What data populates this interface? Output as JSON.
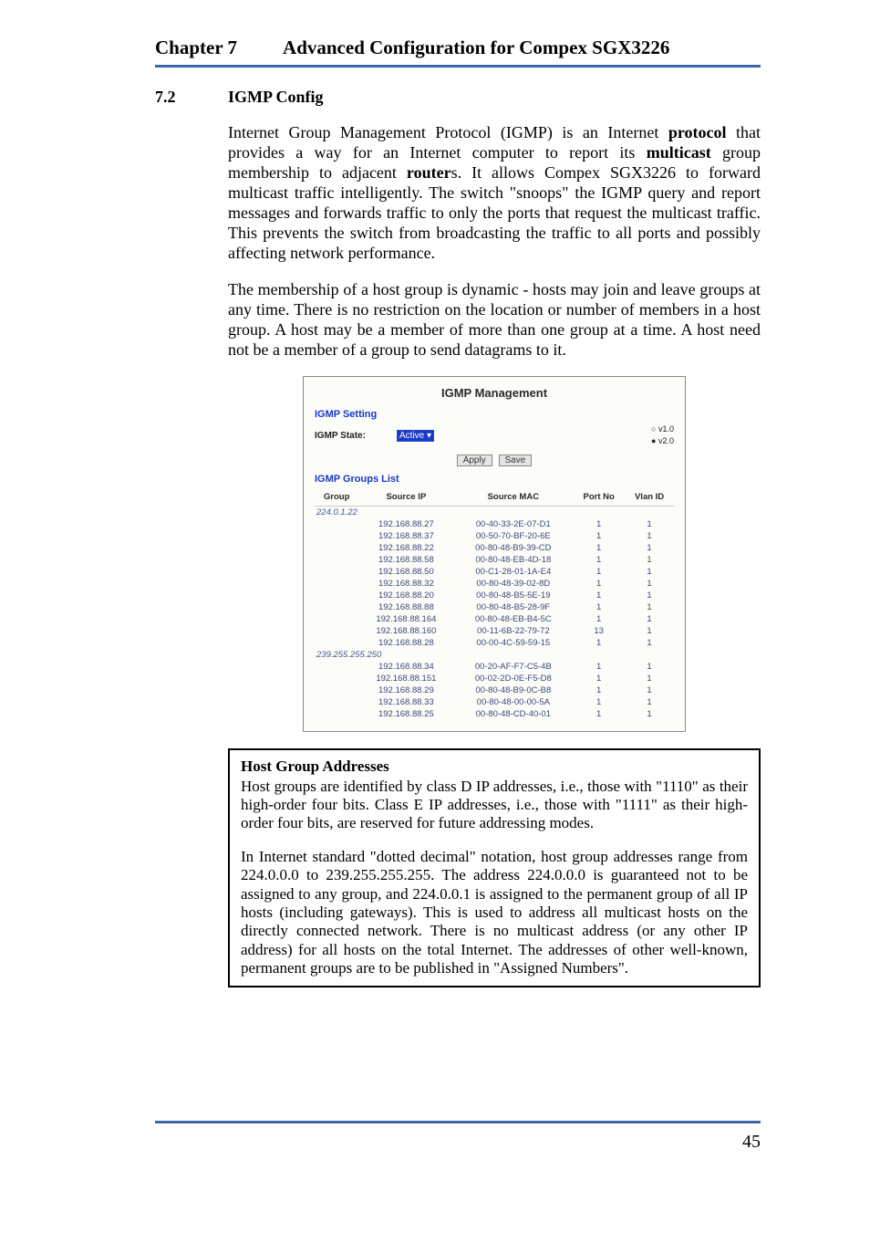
{
  "header": {
    "chapter": "Chapter 7",
    "title": "Advanced Configuration for Compex SGX3226"
  },
  "section": {
    "num": "7.2",
    "title": "IGMP Config"
  },
  "paragraphs": {
    "p1_a": "Internet Group Management Protocol (IGMP) is an Internet ",
    "p1_b": "protocol",
    "p1_c": " that provides a way for an Internet computer to report its ",
    "p1_d": "multicast",
    "p1_e": " group membership to adjacent ",
    "p1_f": "router",
    "p1_g": "s. It allows Compex SGX3226 to forward multicast traffic intelligently. The switch \"snoops\" the IGMP query and report messages and forwards traffic to only the ports that request the multicast traffic. This prevents the switch from broadcasting the traffic to all ports and possibly affecting network performance.",
    "p2": "The membership of a host group is dynamic - hosts may join and leave groups at any time. There is no restriction on the location or number of members in a host group. A host may be a member of more than one group at a time. A host need not be a member of a group to send datagrams to it."
  },
  "figure": {
    "title": "IGMP Management",
    "section1": "IGMP Setting",
    "state_label": "IGMP State:",
    "state_value": "Active",
    "v1": "v1.0",
    "v2": "v2.0",
    "apply": "Apply",
    "save": "Save",
    "section2": "IGMP Groups List",
    "cols": {
      "group": "Group",
      "sip": "Source IP",
      "smac": "Source MAC",
      "port": "Port No",
      "vlan": "Vlan ID"
    },
    "group1": "224.0.1.22",
    "group2": "239.255.255.250",
    "rows1": [
      {
        "ip": "192.168.88.27",
        "mac": "00-40-33-2E-07-D1",
        "port": "1",
        "vlan": "1"
      },
      {
        "ip": "192.168.88.37",
        "mac": "00-50-70-BF-20-6E",
        "port": "1",
        "vlan": "1"
      },
      {
        "ip": "192.168.88.22",
        "mac": "00-80-48-B9-39-CD",
        "port": "1",
        "vlan": "1"
      },
      {
        "ip": "192.168.88.58",
        "mac": "00-80-48-EB-4D-18",
        "port": "1",
        "vlan": "1"
      },
      {
        "ip": "192.168.88.50",
        "mac": "00-C1-28-01-1A-E4",
        "port": "1",
        "vlan": "1"
      },
      {
        "ip": "192.168.88.32",
        "mac": "00-80-48-39-02-8D",
        "port": "1",
        "vlan": "1"
      },
      {
        "ip": "192.168.88.20",
        "mac": "00-80-48-B5-5E-19",
        "port": "1",
        "vlan": "1"
      },
      {
        "ip": "192.168.88.88",
        "mac": "00-80-48-B5-28-9F",
        "port": "1",
        "vlan": "1"
      },
      {
        "ip": "192.168.88.164",
        "mac": "00-80-48-EB-B4-5C",
        "port": "1",
        "vlan": "1"
      },
      {
        "ip": "192.168.88.160",
        "mac": "00-11-6B-22-79-72",
        "port": "13",
        "vlan": "1"
      },
      {
        "ip": "192.168.88.28",
        "mac": "00-00-4C-59-59-15",
        "port": "1",
        "vlan": "1"
      }
    ],
    "rows2": [
      {
        "ip": "192.168.88.34",
        "mac": "00-20-AF-F7-C5-4B",
        "port": "1",
        "vlan": "1"
      },
      {
        "ip": "192.168.88.151",
        "mac": "00-02-2D-0E-F5-D8",
        "port": "1",
        "vlan": "1"
      },
      {
        "ip": "192.168.88.29",
        "mac": "00-80-48-B9-0C-B8",
        "port": "1",
        "vlan": "1"
      },
      {
        "ip": "192.168.88.33",
        "mac": "00-80-48-00-00-5A",
        "port": "1",
        "vlan": "1"
      },
      {
        "ip": "192.168.88.25",
        "mac": "00-80-48-CD-40-01",
        "port": "1",
        "vlan": "1"
      }
    ]
  },
  "note": {
    "title": "Host Group Addresses",
    "p1": "Host groups are identified by class D IP addresses, i.e., those with \"1110\" as their high-order four bits. Class E IP addresses, i.e., those with \"1111\" as their high-order four bits, are reserved for future addressing modes.",
    "p2": "In Internet standard \"dotted decimal\" notation, host group addresses range from 224.0.0.0 to 239.255.255.255. The address 224.0.0.0 is  guaranteed not to be assigned to any group, and 224.0.0.1 is assigned to the permanent group of all IP hosts (including gateways). This is used to address all multicast hosts on the directly connected network. There is no multicast address (or any other IP address) for all hosts on the total Internet. The addresses of other well-known, permanent groups are to be published in \"Assigned Numbers\"."
  },
  "page_number": "45"
}
